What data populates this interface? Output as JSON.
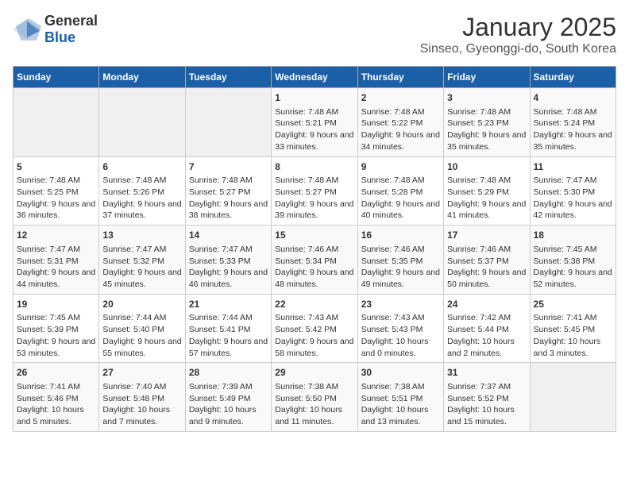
{
  "logo": {
    "general": "General",
    "blue": "Blue"
  },
  "title": "January 2025",
  "subtitle": "Sinseo, Gyeonggi-do, South Korea",
  "days_of_week": [
    "Sunday",
    "Monday",
    "Tuesday",
    "Wednesday",
    "Thursday",
    "Friday",
    "Saturday"
  ],
  "weeks": [
    [
      {
        "day": "",
        "content": ""
      },
      {
        "day": "",
        "content": ""
      },
      {
        "day": "",
        "content": ""
      },
      {
        "day": "1",
        "content": "Sunrise: 7:48 AM\nSunset: 5:21 PM\nDaylight: 9 hours and 33 minutes."
      },
      {
        "day": "2",
        "content": "Sunrise: 7:48 AM\nSunset: 5:22 PM\nDaylight: 9 hours and 34 minutes."
      },
      {
        "day": "3",
        "content": "Sunrise: 7:48 AM\nSunset: 5:23 PM\nDaylight: 9 hours and 35 minutes."
      },
      {
        "day": "4",
        "content": "Sunrise: 7:48 AM\nSunset: 5:24 PM\nDaylight: 9 hours and 35 minutes."
      }
    ],
    [
      {
        "day": "5",
        "content": "Sunrise: 7:48 AM\nSunset: 5:25 PM\nDaylight: 9 hours and 36 minutes."
      },
      {
        "day": "6",
        "content": "Sunrise: 7:48 AM\nSunset: 5:26 PM\nDaylight: 9 hours and 37 minutes."
      },
      {
        "day": "7",
        "content": "Sunrise: 7:48 AM\nSunset: 5:27 PM\nDaylight: 9 hours and 38 minutes."
      },
      {
        "day": "8",
        "content": "Sunrise: 7:48 AM\nSunset: 5:27 PM\nDaylight: 9 hours and 39 minutes."
      },
      {
        "day": "9",
        "content": "Sunrise: 7:48 AM\nSunset: 5:28 PM\nDaylight: 9 hours and 40 minutes."
      },
      {
        "day": "10",
        "content": "Sunrise: 7:48 AM\nSunset: 5:29 PM\nDaylight: 9 hours and 41 minutes."
      },
      {
        "day": "11",
        "content": "Sunrise: 7:47 AM\nSunset: 5:30 PM\nDaylight: 9 hours and 42 minutes."
      }
    ],
    [
      {
        "day": "12",
        "content": "Sunrise: 7:47 AM\nSunset: 5:31 PM\nDaylight: 9 hours and 44 minutes."
      },
      {
        "day": "13",
        "content": "Sunrise: 7:47 AM\nSunset: 5:32 PM\nDaylight: 9 hours and 45 minutes."
      },
      {
        "day": "14",
        "content": "Sunrise: 7:47 AM\nSunset: 5:33 PM\nDaylight: 9 hours and 46 minutes."
      },
      {
        "day": "15",
        "content": "Sunrise: 7:46 AM\nSunset: 5:34 PM\nDaylight: 9 hours and 48 minutes."
      },
      {
        "day": "16",
        "content": "Sunrise: 7:46 AM\nSunset: 5:35 PM\nDaylight: 9 hours and 49 minutes."
      },
      {
        "day": "17",
        "content": "Sunrise: 7:46 AM\nSunset: 5:37 PM\nDaylight: 9 hours and 50 minutes."
      },
      {
        "day": "18",
        "content": "Sunrise: 7:45 AM\nSunset: 5:38 PM\nDaylight: 9 hours and 52 minutes."
      }
    ],
    [
      {
        "day": "19",
        "content": "Sunrise: 7:45 AM\nSunset: 5:39 PM\nDaylight: 9 hours and 53 minutes."
      },
      {
        "day": "20",
        "content": "Sunrise: 7:44 AM\nSunset: 5:40 PM\nDaylight: 9 hours and 55 minutes."
      },
      {
        "day": "21",
        "content": "Sunrise: 7:44 AM\nSunset: 5:41 PM\nDaylight: 9 hours and 57 minutes."
      },
      {
        "day": "22",
        "content": "Sunrise: 7:43 AM\nSunset: 5:42 PM\nDaylight: 9 hours and 58 minutes."
      },
      {
        "day": "23",
        "content": "Sunrise: 7:43 AM\nSunset: 5:43 PM\nDaylight: 10 hours and 0 minutes."
      },
      {
        "day": "24",
        "content": "Sunrise: 7:42 AM\nSunset: 5:44 PM\nDaylight: 10 hours and 2 minutes."
      },
      {
        "day": "25",
        "content": "Sunrise: 7:41 AM\nSunset: 5:45 PM\nDaylight: 10 hours and 3 minutes."
      }
    ],
    [
      {
        "day": "26",
        "content": "Sunrise: 7:41 AM\nSunset: 5:46 PM\nDaylight: 10 hours and 5 minutes."
      },
      {
        "day": "27",
        "content": "Sunrise: 7:40 AM\nSunset: 5:48 PM\nDaylight: 10 hours and 7 minutes."
      },
      {
        "day": "28",
        "content": "Sunrise: 7:39 AM\nSunset: 5:49 PM\nDaylight: 10 hours and 9 minutes."
      },
      {
        "day": "29",
        "content": "Sunrise: 7:38 AM\nSunset: 5:50 PM\nDaylight: 10 hours and 11 minutes."
      },
      {
        "day": "30",
        "content": "Sunrise: 7:38 AM\nSunset: 5:51 PM\nDaylight: 10 hours and 13 minutes."
      },
      {
        "day": "31",
        "content": "Sunrise: 7:37 AM\nSunset: 5:52 PM\nDaylight: 10 hours and 15 minutes."
      },
      {
        "day": "",
        "content": ""
      }
    ]
  ]
}
